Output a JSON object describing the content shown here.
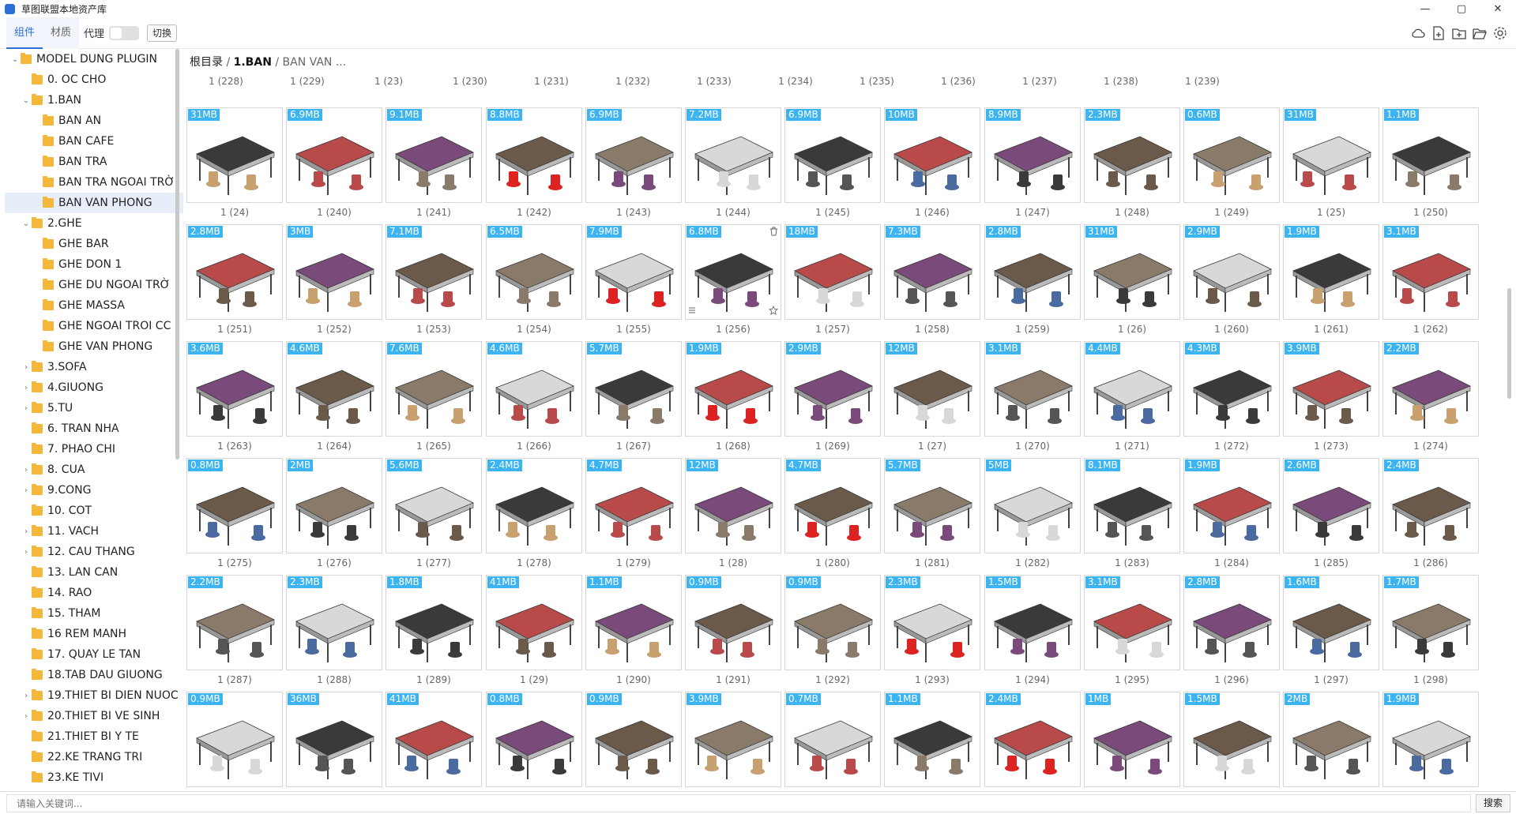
{
  "window": {
    "title": "草图联盟本地资产库",
    "min": "—",
    "max": "▢",
    "close": "✕"
  },
  "toolbar": {
    "tabs": [
      "组件",
      "材质"
    ],
    "proxy_label": "代理",
    "switch_label": "切换",
    "icons": [
      "cloud-icon",
      "file-add-icon",
      "folder-add-icon",
      "folder-open-icon",
      "settings-icon"
    ]
  },
  "sidebar": {
    "items": [
      {
        "label": "MODEL DUNG PLUGIN",
        "level": 0,
        "caret": "⌄"
      },
      {
        "label": "0. OC CHO",
        "level": 1,
        "caret": ""
      },
      {
        "label": "1.BAN",
        "level": 1,
        "caret": "⌄"
      },
      {
        "label": "BAN AN",
        "level": 2,
        "caret": ""
      },
      {
        "label": "BAN CAFE",
        "level": 2,
        "caret": ""
      },
      {
        "label": "BAN TRA",
        "level": 2,
        "caret": ""
      },
      {
        "label": "BAN TRA NGOAI TRỜ",
        "level": 2,
        "caret": ""
      },
      {
        "label": "BAN VAN PHONG",
        "level": 2,
        "caret": "",
        "selected": true
      },
      {
        "label": "2.GHE",
        "level": 1,
        "caret": "⌄"
      },
      {
        "label": "GHE BAR",
        "level": 2,
        "caret": ""
      },
      {
        "label": "GHE DON 1",
        "level": 2,
        "caret": ""
      },
      {
        "label": "GHE DU NGOAI TRỜ",
        "level": 2,
        "caret": ""
      },
      {
        "label": "GHE MASSA",
        "level": 2,
        "caret": ""
      },
      {
        "label": "GHE NGOAI TROI CC",
        "level": 2,
        "caret": ""
      },
      {
        "label": "GHE VAN PHONG",
        "level": 2,
        "caret": ""
      },
      {
        "label": "3.SOFA",
        "level": 1,
        "caret": "›"
      },
      {
        "label": "4.GIUONG",
        "level": 1,
        "caret": "›"
      },
      {
        "label": "5.TU",
        "level": 1,
        "caret": "›"
      },
      {
        "label": "6. TRAN NHA",
        "level": 1,
        "caret": ""
      },
      {
        "label": "7. PHAO CHI",
        "level": 1,
        "caret": ""
      },
      {
        "label": "8. CUA",
        "level": 1,
        "caret": "›"
      },
      {
        "label": "9.CONG",
        "level": 1,
        "caret": "›"
      },
      {
        "label": "10. COT",
        "level": 1,
        "caret": ""
      },
      {
        "label": "11. VACH",
        "level": 1,
        "caret": "›"
      },
      {
        "label": "12. CAU THANG",
        "level": 1,
        "caret": "›"
      },
      {
        "label": "13. LAN CAN",
        "level": 1,
        "caret": ""
      },
      {
        "label": "14. RAO",
        "level": 1,
        "caret": ""
      },
      {
        "label": "15. THAM",
        "level": 1,
        "caret": ""
      },
      {
        "label": "16 REM MANH",
        "level": 1,
        "caret": ""
      },
      {
        "label": "17. QUAY LE TAN",
        "level": 1,
        "caret": ""
      },
      {
        "label": "18.TAB DAU GIUONG",
        "level": 1,
        "caret": ""
      },
      {
        "label": "19.THIET BI DIEN NUOC",
        "level": 1,
        "caret": "›"
      },
      {
        "label": "20.THIET BI VE SINH",
        "level": 1,
        "caret": "›"
      },
      {
        "label": "21.THIET BI Y TE",
        "level": 1,
        "caret": ""
      },
      {
        "label": "22.KE TRANG TRI",
        "level": 1,
        "caret": ""
      },
      {
        "label": "23.KE TIVI",
        "level": 1,
        "caret": ""
      }
    ]
  },
  "breadcrumb": {
    "root": "根目录",
    "sep": "/",
    "level1": "1.BAN",
    "level2": "BAN VAN ..."
  },
  "partial_row": [
    "1 (228)",
    "1 (229)",
    "1 (23)",
    "1 (230)",
    "1 (231)",
    "1 (232)",
    "1 (233)",
    "1 (234)",
    "1 (235)",
    "1 (236)",
    "1 (237)",
    "1 (238)",
    "1 (239)"
  ],
  "assets": [
    [
      {
        "size": "31MB",
        "label": "1 (24)"
      },
      {
        "size": "6.9MB",
        "label": "1 (240)"
      },
      {
        "size": "9.1MB",
        "label": "1 (241)"
      },
      {
        "size": "8.8MB",
        "label": "1 (242)"
      },
      {
        "size": "6.9MB",
        "label": "1 (243)"
      },
      {
        "size": "7.2MB",
        "label": "1 (244)"
      },
      {
        "size": "6.9MB",
        "label": "1 (245)"
      },
      {
        "size": "10MB",
        "label": "1 (246)"
      },
      {
        "size": "8.9MB",
        "label": "1 (247)"
      },
      {
        "size": "2.3MB",
        "label": "1 (248)"
      },
      {
        "size": "0.6MB",
        "label": "1 (249)"
      },
      {
        "size": "31MB",
        "label": "1 (25)"
      },
      {
        "size": "1.1MB",
        "label": "1 (250)"
      }
    ],
    [
      {
        "size": "2.8MB",
        "label": "1 (251)"
      },
      {
        "size": "3MB",
        "label": "1 (252)"
      },
      {
        "size": "7.1MB",
        "label": "1 (253)"
      },
      {
        "size": "6.5MB",
        "label": "1 (254)"
      },
      {
        "size": "7.9MB",
        "label": "1 (255)"
      },
      {
        "size": "6.8MB",
        "label": "1 (256)",
        "hover": true
      },
      {
        "size": "18MB",
        "label": "1 (257)"
      },
      {
        "size": "7.3MB",
        "label": "1 (258)"
      },
      {
        "size": "2.8MB",
        "label": "1 (259)"
      },
      {
        "size": "31MB",
        "label": "1 (26)"
      },
      {
        "size": "2.9MB",
        "label": "1 (260)"
      },
      {
        "size": "1.9MB",
        "label": "1 (261)"
      },
      {
        "size": "3.1MB",
        "label": "1 (262)"
      }
    ],
    [
      {
        "size": "3.6MB",
        "label": "1 (263)"
      },
      {
        "size": "4.6MB",
        "label": "1 (264)"
      },
      {
        "size": "7.6MB",
        "label": "1 (265)"
      },
      {
        "size": "4.6MB",
        "label": "1 (266)"
      },
      {
        "size": "5.7MB",
        "label": "1 (267)"
      },
      {
        "size": "1.9MB",
        "label": "1 (268)"
      },
      {
        "size": "2.9MB",
        "label": "1 (269)"
      },
      {
        "size": "12MB",
        "label": "1 (27)"
      },
      {
        "size": "3.1MB",
        "label": "1 (270)"
      },
      {
        "size": "4.4MB",
        "label": "1 (271)"
      },
      {
        "size": "4.3MB",
        "label": "1 (272)"
      },
      {
        "size": "3.9MB",
        "label": "1 (273)"
      },
      {
        "size": "2.2MB",
        "label": "1 (274)"
      }
    ],
    [
      {
        "size": "0.8MB",
        "label": "1 (275)"
      },
      {
        "size": "2MB",
        "label": "1 (276)"
      },
      {
        "size": "5.6MB",
        "label": "1 (277)"
      },
      {
        "size": "2.4MB",
        "label": "1 (278)"
      },
      {
        "size": "4.7MB",
        "label": "1 (279)"
      },
      {
        "size": "12MB",
        "label": "1 (28)"
      },
      {
        "size": "4.7MB",
        "label": "1 (280)"
      },
      {
        "size": "5.7MB",
        "label": "1 (281)"
      },
      {
        "size": "5MB",
        "label": "1 (282)"
      },
      {
        "size": "8.1MB",
        "label": "1 (283)"
      },
      {
        "size": "1.9MB",
        "label": "1 (284)"
      },
      {
        "size": "2.6MB",
        "label": "1 (285)"
      },
      {
        "size": "2.4MB",
        "label": "1 (286)"
      }
    ],
    [
      {
        "size": "2.2MB",
        "label": "1 (287)"
      },
      {
        "size": "2.3MB",
        "label": "1 (288)"
      },
      {
        "size": "1.8MB",
        "label": "1 (289)"
      },
      {
        "size": "41MB",
        "label": "1 (29)"
      },
      {
        "size": "1.1MB",
        "label": "1 (290)"
      },
      {
        "size": "0.9MB",
        "label": "1 (291)"
      },
      {
        "size": "0.9MB",
        "label": "1 (292)"
      },
      {
        "size": "2.3MB",
        "label": "1 (293)"
      },
      {
        "size": "1.5MB",
        "label": "1 (294)"
      },
      {
        "size": "3.1MB",
        "label": "1 (295)"
      },
      {
        "size": "2.8MB",
        "label": "1 (296)"
      },
      {
        "size": "1.6MB",
        "label": "1 (297)"
      },
      {
        "size": "1.7MB",
        "label": "1 (298)"
      }
    ],
    [
      {
        "size": "0.9MB",
        "label": ""
      },
      {
        "size": "36MB",
        "label": ""
      },
      {
        "size": "41MB",
        "label": ""
      },
      {
        "size": "0.8MB",
        "label": ""
      },
      {
        "size": "0.9MB",
        "label": ""
      },
      {
        "size": "3.9MB",
        "label": ""
      },
      {
        "size": "0.7MB",
        "label": ""
      },
      {
        "size": "1.1MB",
        "label": ""
      },
      {
        "size": "2.4MB",
        "label": ""
      },
      {
        "size": "1MB",
        "label": ""
      },
      {
        "size": "1.5MB",
        "label": ""
      },
      {
        "size": "2MB",
        "label": ""
      },
      {
        "size": "1.9MB",
        "label": ""
      }
    ]
  ],
  "search": {
    "placeholder": "请输入关键词...",
    "button": "搜索"
  },
  "colors": {
    "accent": "#2d6fd6",
    "badge": "#3cb4f2",
    "folder": "#f3b73b",
    "selected_bg": "#e8eef9"
  }
}
